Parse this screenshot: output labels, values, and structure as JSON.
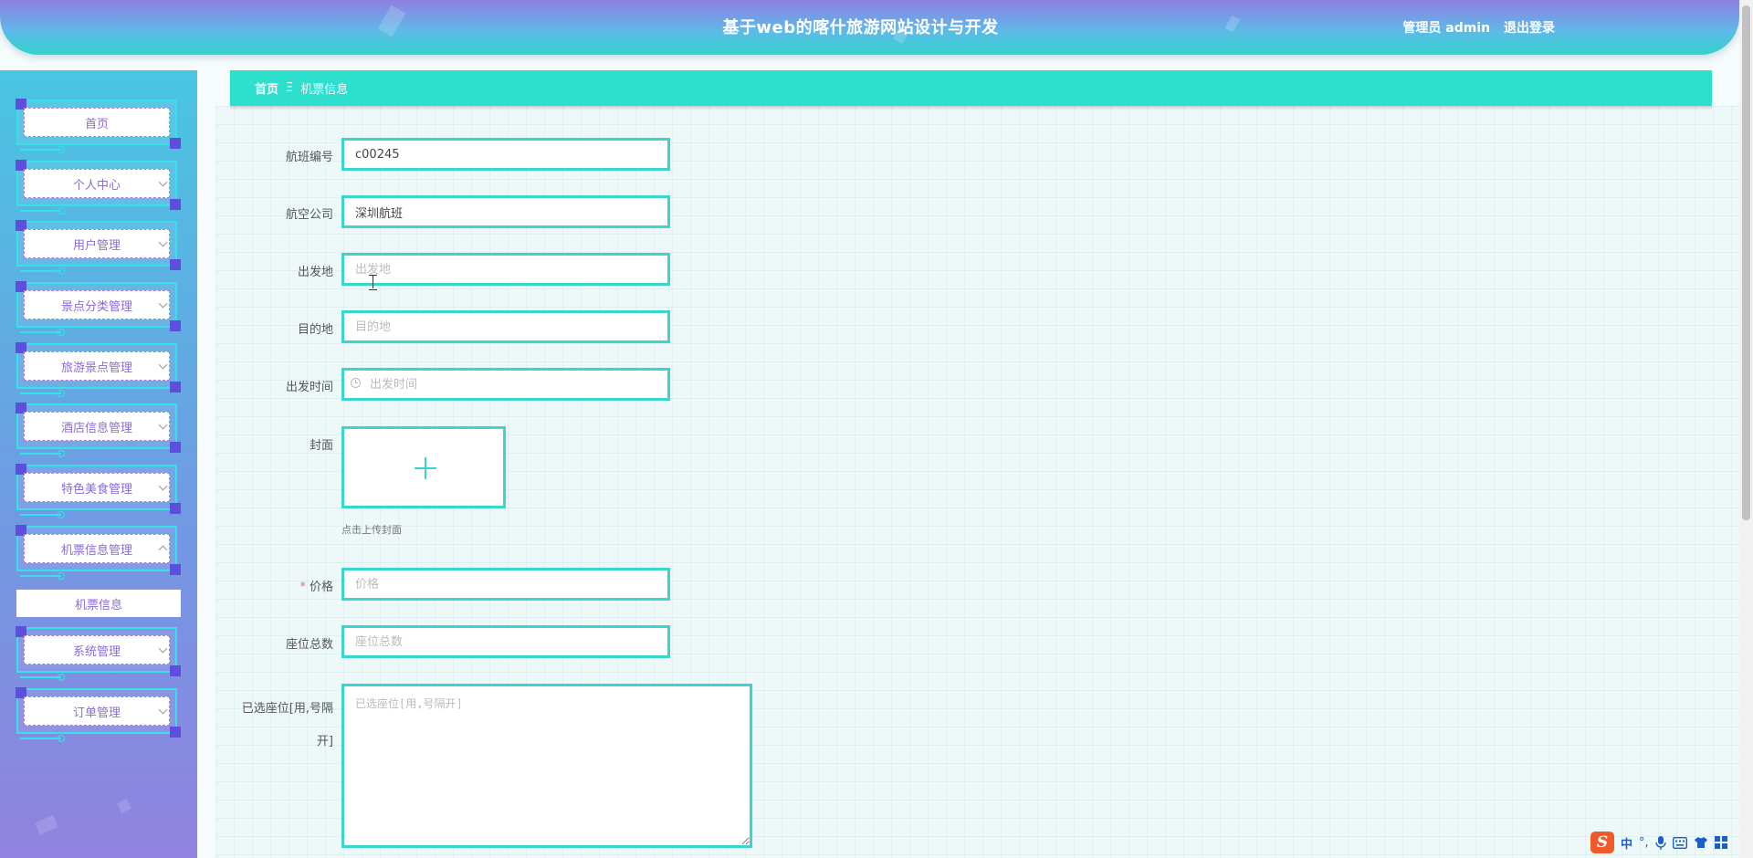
{
  "header": {
    "title": "基于web的喀什旅游网站设计与开发",
    "user_label": "管理员 admin",
    "logout": "退出登录"
  },
  "sidebar": {
    "items": [
      {
        "label": "首页",
        "expandable": false
      },
      {
        "label": "个人中心",
        "expandable": true
      },
      {
        "label": "用户管理",
        "expandable": true
      },
      {
        "label": "景点分类管理",
        "expandable": true
      },
      {
        "label": "旅游景点管理",
        "expandable": true
      },
      {
        "label": "酒店信息管理",
        "expandable": true
      },
      {
        "label": "特色美食管理",
        "expandable": true
      },
      {
        "label": "机票信息管理",
        "expandable": true,
        "expanded": true
      },
      {
        "label": "系统管理",
        "expandable": true
      },
      {
        "label": "订单管理",
        "expandable": true
      }
    ],
    "submenu": {
      "label": "机票信息"
    }
  },
  "breadcrumb": {
    "home": "首页",
    "separator": "Ξ",
    "current": "机票信息"
  },
  "form": {
    "flight_no": {
      "label": "航班编号",
      "value": "c00245",
      "placeholder": "航班编号"
    },
    "airline": {
      "label": "航空公司",
      "value": "深圳航班",
      "placeholder": "航空公司"
    },
    "origin": {
      "label": "出发地",
      "value": "",
      "placeholder": "出发地"
    },
    "destination": {
      "label": "目的地",
      "value": "",
      "placeholder": "目的地"
    },
    "depart_time": {
      "label": "出发时间",
      "value": "",
      "placeholder": "出发时间"
    },
    "cover": {
      "label": "封面",
      "hint": "点击上传封面"
    },
    "price": {
      "label": "价格",
      "required_mark": "*",
      "value": "",
      "placeholder": "价格"
    },
    "seats_total": {
      "label": "座位总数",
      "value": "",
      "placeholder": "座位总数"
    },
    "seats_selected": {
      "label_line1": "已选座位[用,号隔",
      "label_line2": "开]",
      "value": "",
      "placeholder": "已选座位[用,号隔开]"
    }
  },
  "ime": {
    "logo": "S",
    "mode": "中",
    "punct": "°,",
    "icons": [
      "microphone-icon",
      "keyboard-icon",
      "shirt-icon",
      "grid-icon"
    ]
  },
  "colors": {
    "accent": "#2ddfcd",
    "input_border": "#3ad5cc",
    "menu_text": "#8b6bd9",
    "required": "#f56c6c"
  }
}
